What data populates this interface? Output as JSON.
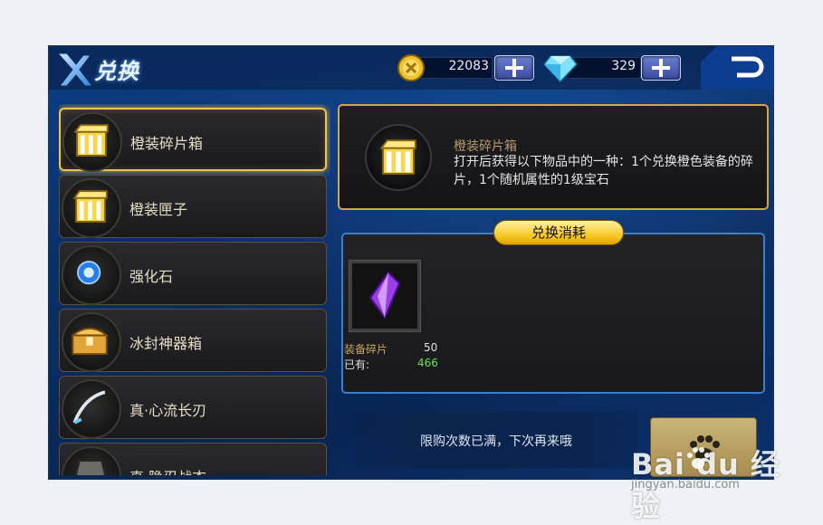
{
  "header": {
    "title": "兑换",
    "gold": "22083",
    "diamonds": "329"
  },
  "items": [
    {
      "label": "橙装碎片箱",
      "icon": "golden-chest-icon",
      "selected": true
    },
    {
      "label": "橙装匣子",
      "icon": "golden-box-icon",
      "selected": false
    },
    {
      "label": "强化石",
      "icon": "enhancement-stone-icon",
      "selected": false
    },
    {
      "label": "冰封神器箱",
      "icon": "treasure-chest-icon",
      "selected": false
    },
    {
      "label": "真·心流长刃",
      "icon": "blade-icon",
      "selected": false
    },
    {
      "label": "真·隐忍战衣",
      "icon": "armor-icon",
      "selected": false
    }
  ],
  "detail": {
    "name": "橙装碎片箱",
    "description": "打开后获得以下物品中的一种：1个兑换橙色装备的碎片，1个随机属性的1级宝石"
  },
  "exchange": {
    "label": "兑换消耗",
    "cost_item_name": "装备碎片",
    "cost_required": "50",
    "owned_label": "已有:",
    "owned_value": "466"
  },
  "footer": {
    "limit_message": "限购次数已满，下次再来哦"
  },
  "watermark": {
    "brand": "Bai  du 经验",
    "url": "jingyan.baidu.com"
  }
}
